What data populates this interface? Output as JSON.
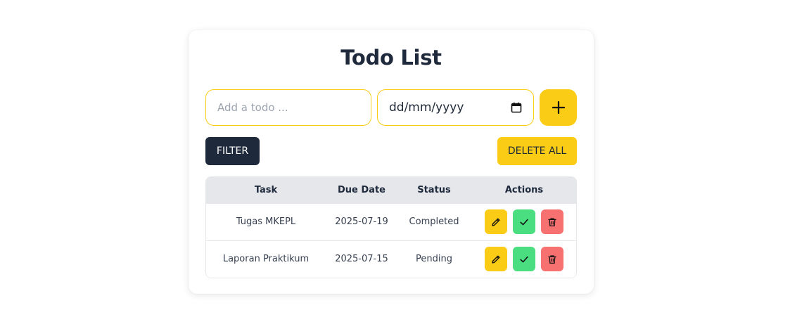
{
  "app": {
    "title": "Todo List"
  },
  "form": {
    "todo_placeholder": "Add a todo ...",
    "todo_value": "",
    "date_placeholder": "dd/mm/yyyy",
    "add_icon": "plus-icon"
  },
  "toolbar": {
    "filter_label": "FILTER",
    "delete_all_label": "DELETE ALL"
  },
  "table": {
    "headers": [
      "Task",
      "Due Date",
      "Status",
      "Actions"
    ],
    "rows": [
      {
        "task": "Tugas MKEPL",
        "due_date": "2025-07-19",
        "status": "Completed"
      },
      {
        "task": "Laporan Praktikum",
        "due_date": "2025-07-15",
        "status": "Pending"
      }
    ],
    "action_icons": [
      "pencil-icon",
      "check-icon",
      "trash-icon"
    ]
  },
  "colors": {
    "accent": "#facc15",
    "dark": "#1e293b",
    "success": "#4ade80",
    "danger": "#f87171",
    "header_bg": "#e5e7eb"
  }
}
